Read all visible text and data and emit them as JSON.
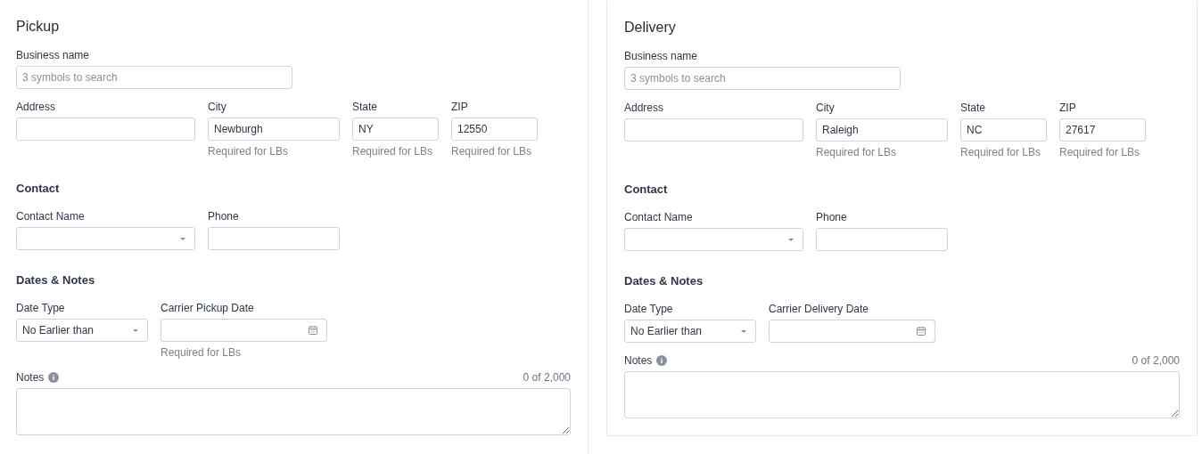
{
  "panels": [
    {
      "title": "Pickup",
      "sections": [
        {
          "rows": [
            [
              {
                "kind": "text",
                "label": "Business name",
                "placeholder": "3 symbols to search"
              }
            ],
            [
              {
                "kind": "text",
                "label": "Address"
              },
              {
                "kind": "text",
                "label": "City",
                "value": "Newburgh",
                "hint": "Required for LBs"
              },
              {
                "kind": "text",
                "label": "State",
                "value": "NY",
                "hint": "Required for LBs"
              },
              {
                "kind": "text",
                "label": "ZIP",
                "value": "12550",
                "hint": "Required for LBs"
              }
            ]
          ]
        },
        {
          "heading": "Contact",
          "rows": [
            [
              {
                "kind": "select",
                "label": "Contact Name"
              },
              {
                "kind": "text",
                "label": "Phone"
              }
            ]
          ]
        },
        {
          "heading": "Dates & Notes",
          "rows": [
            [
              {
                "kind": "select",
                "label": "Date Type",
                "value": "No Earlier than"
              },
              {
                "kind": "date",
                "label": "Carrier Pickup Date",
                "hint": "Required for LBs"
              }
            ],
            [
              {
                "kind": "textarea",
                "label": "Notes",
                "counter": "0 of 2,000"
              }
            ]
          ]
        }
      ]
    },
    {
      "title": "Delivery",
      "sections": [
        {
          "rows": [
            [
              {
                "kind": "text",
                "label": "Business name",
                "placeholder": "3 symbols to search"
              }
            ],
            [
              {
                "kind": "text",
                "label": "Address"
              },
              {
                "kind": "text",
                "label": "City",
                "value": "Raleigh",
                "hint": "Required for LBs"
              },
              {
                "kind": "text",
                "label": "State",
                "value": "NC",
                "hint": "Required for LBs"
              },
              {
                "kind": "text",
                "label": "ZIP",
                "value": "27617",
                "hint": "Required for LBs"
              }
            ]
          ]
        },
        {
          "heading": "Contact",
          "rows": [
            [
              {
                "kind": "select",
                "label": "Contact Name"
              },
              {
                "kind": "text",
                "label": "Phone"
              }
            ]
          ]
        },
        {
          "heading": "Dates & Notes",
          "rows": [
            [
              {
                "kind": "select",
                "label": "Date Type",
                "value": "No Earlier than"
              },
              {
                "kind": "date",
                "label": "Carrier Delivery Date"
              }
            ],
            [
              {
                "kind": "textarea",
                "label": "Notes",
                "counter": "0 of 2,000"
              }
            ]
          ]
        }
      ]
    }
  ]
}
